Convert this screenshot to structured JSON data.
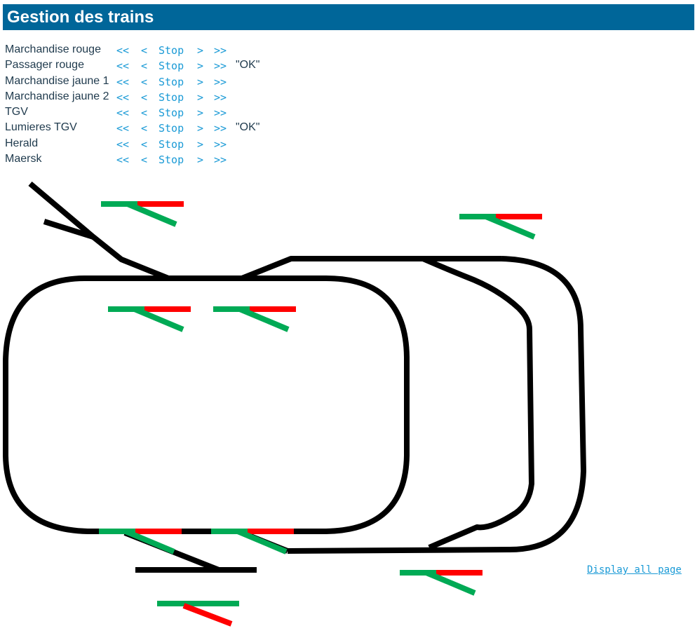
{
  "header": {
    "title": "Gestion des trains"
  },
  "controls": {
    "fast_back": "<<",
    "back": "<",
    "stop": "Stop",
    "forward": ">",
    "fast_forward": ">>"
  },
  "trains": [
    {
      "name": "Marchandise rouge",
      "status": ""
    },
    {
      "name": "Passager rouge",
      "status": "\"OK\""
    },
    {
      "name": "Marchandise jaune 1",
      "status": ""
    },
    {
      "name": "Marchandise jaune 2",
      "status": ""
    },
    {
      "name": "TGV",
      "status": ""
    },
    {
      "name": "Lumieres TGV",
      "status": "\"OK\""
    },
    {
      "name": "Herald",
      "status": ""
    },
    {
      "name": "Maersk",
      "status": ""
    }
  ],
  "footer": {
    "display_all_link": "Display all page"
  },
  "colors": {
    "header_bg": "#006699",
    "link": "#1a9ad6",
    "track": "#000000",
    "switch_straight": "#00aa55",
    "switch_diverge": "#ff0000"
  }
}
